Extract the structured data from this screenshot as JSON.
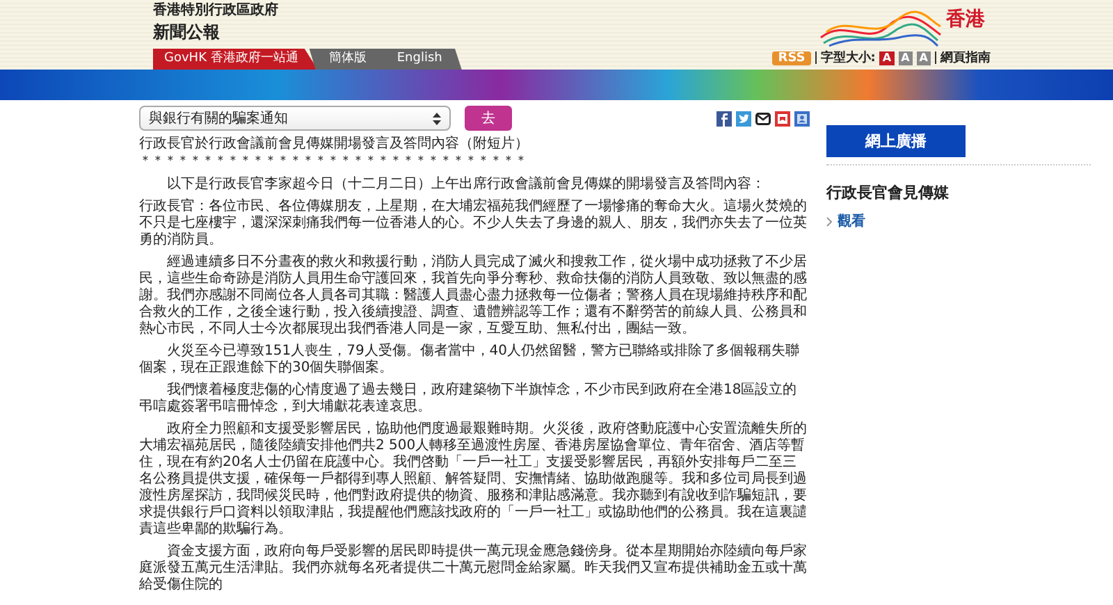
{
  "header": {
    "org": "香港特別行政區政府",
    "title": "新聞公報",
    "logo_text": "香港",
    "nav": [
      {
        "label": "GovHK 香港政府一站通",
        "kind": "home"
      },
      {
        "label": "簡体版",
        "kind": "lang"
      },
      {
        "label": "English",
        "kind": "lang"
      }
    ],
    "tools": {
      "rss": "RSS",
      "font_label": "字型大小:",
      "font_sizes": [
        {
          "label": "A",
          "selected": true
        },
        {
          "label": "A",
          "selected": false
        },
        {
          "label": "A",
          "selected": false
        }
      ],
      "guide": "網頁指南"
    }
  },
  "toolbar": {
    "select_value": "與銀行有關的騙案通知",
    "go": "去"
  },
  "article": {
    "title": "行政長官於行政會議前會見傳媒開場發言及答問內容（附短片）",
    "stars": "＊＊＊＊＊＊＊＊＊＊＊＊＊＊＊＊＊＊＊＊＊＊＊＊＊＊＊＊＊＊＊",
    "paragraphs": [
      {
        "text": "以下是行政長官李家超今日（十二月二日）上午出席行政會議前會見傳媒的開場發言及答問內容：",
        "indent": true
      },
      {
        "text": "行政長官：各位市民、各位傳媒朋友，上星期，在大埔宏福苑我們經歷了一場慘痛的奪命大火。這場火焚燒的不只是七座樓宇，還深深刺痛我們每一位香港人的心。不少人失去了身邊的親人、朋友，我們亦失去了一位英勇的消防員。",
        "indent": false
      },
      {
        "text": "經過連續多日不分晝夜的救火和救援行動，消防人員完成了滅火和搜救工作，從火場中成功拯救了不少居民，這些生命奇跡是消防人員用生命守護回來，我首先向爭分奪秒、救命扶傷的消防人員致敬、致以無盡的感謝。我們亦感謝不同崗位各人員各司其職：醫護人員盡心盡力拯救每一位傷者；警務人員在現場維持秩序和配合救火的工作，之後全速行動，投入後續搜證、調查、遺體辨認等工作；還有不辭勞苦的前線人員、公務員和熱心市民，不同人士今次都展現出我們香港人同是一家，互愛互助、無私付出，團結一致。",
        "indent": true
      },
      {
        "text": "火災至今已導致151人喪生，79人受傷。傷者當中，40人仍然留醫，警方已聯絡或排除了多個報稱失聯個案，現在正跟進餘下的30個失聯個案。",
        "indent": true
      },
      {
        "text": "我們懷着極度悲傷的心情度過了過去幾日，政府建築物下半旗悼念，不少市民到政府在全港18區設立的弔唁處簽署弔唁冊悼念，到大埔獻花表達哀思。",
        "indent": true
      },
      {
        "text": "政府全力照顧和支援受影響居民，協助他們度過最艱難時期。火災後，政府啓動庇護中心安置流離失所的大埔宏福苑居民，隨後陸續安排他們共2 500人轉移至過渡性房屋、香港房屋協會單位、青年宿舍、酒店等暫住，現在有約20名人士仍留在庇護中心。我們啓動「一戶一社工」支援受影響居民，再額外安排每戶二至三名公務員提供支援，確保每一戶都得到專人照顧、解答疑問、安撫情緒、協助做跑腿等。我和多位司局長到過渡性房屋探訪，我問候災民時，他們對政府提供的物資、服務和津貼感滿意。我亦聽到有說收到詐騙短訊，要求提供銀行戶口資料以領取津貼，我提醒他們應該找政府的「一戶一社工」或協助他們的公務員。我在這裏譴責這些卑鄙的欺騙行為。",
        "indent": true
      },
      {
        "text": "資金支援方面，政府向每戶受影響的居民即時提供一萬元現金應急錢傍身。從本星期開始亦陸續向每戶家庭派發五萬元生活津貼。我們亦就每名死者提供二十萬元慰問金給家屬。昨天我們又宣布提供補助金五或十萬給受傷住院的",
        "indent": true
      }
    ]
  },
  "sidebar": {
    "heading": "網上廣播",
    "item_title": "行政長官會見傳媒",
    "link": "觀看"
  }
}
